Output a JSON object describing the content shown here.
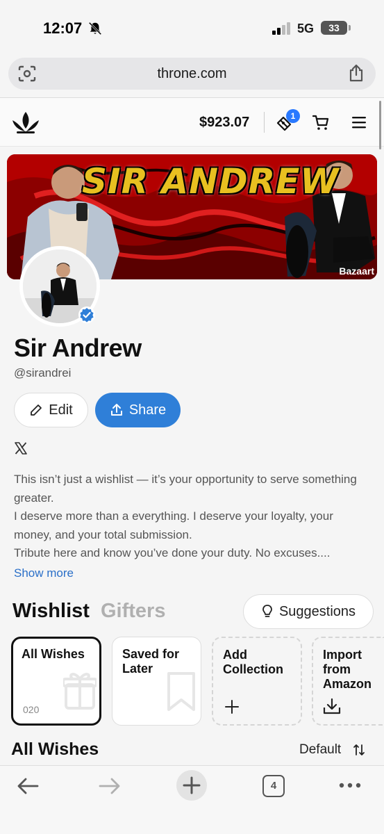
{
  "status_bar": {
    "time": "12:07",
    "network": "5G",
    "battery": "33"
  },
  "browser": {
    "url": "throne.com",
    "open_tabs": "4"
  },
  "header": {
    "balance": "$923.07",
    "notification_count": "1"
  },
  "banner": {
    "title": "SIR ANDREW",
    "watermark": "Bazaart"
  },
  "profile": {
    "name": "Sir Andrew",
    "handle": "@sirandrei",
    "edit_label": "Edit",
    "share_label": "Share",
    "bio": [
      "This isn’t just a wishlist — it’s your opportunity to serve something greater.",
      "I deserve more than a everything. I deserve your loyalty, your money, and your total submission.",
      "Tribute here and know you’ve done your duty. No excuses...."
    ],
    "show_more": "Show more"
  },
  "tabs": {
    "wishlist": "Wishlist",
    "gifters": "Gifters",
    "suggestions": "Suggestions"
  },
  "collections": [
    {
      "label": "All Wishes",
      "count": "020"
    },
    {
      "label": "Saved for Later"
    },
    {
      "label": "Add Collection"
    },
    {
      "label": "Import from Amazon"
    }
  ],
  "list": {
    "title": "All Wishes",
    "sort": "Default"
  },
  "colors": {
    "accent": "#2f7fd8",
    "badge": "#2979ff",
    "link": "#2a6fc8",
    "banner_title": "#e8c020"
  },
  "icons": [
    "bell-off-icon",
    "signal-icon",
    "lens-icon",
    "share-icon",
    "throne-logo",
    "gift-icon",
    "cart-icon",
    "menu-icon",
    "verified-icon",
    "pencil-icon",
    "upload-icon",
    "x-icon",
    "lightbulb-icon",
    "gift-outline-icon",
    "bookmark-icon",
    "plus-icon",
    "download-icon",
    "sort-icon",
    "back-arrow-icon",
    "forward-arrow-icon",
    "more-icon"
  ]
}
